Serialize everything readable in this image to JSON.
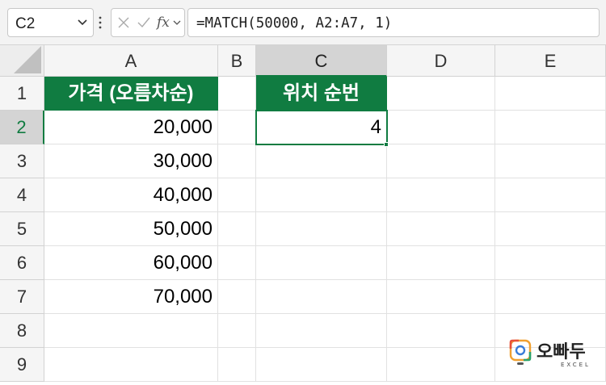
{
  "formula_bar": {
    "name_box": "C2",
    "fx_label": "fx",
    "formula": "=MATCH(50000, A2:A7, 1)"
  },
  "columns": [
    "A",
    "B",
    "C",
    "D",
    "E"
  ],
  "rows": [
    "1",
    "2",
    "3",
    "4",
    "5",
    "6",
    "7",
    "8",
    "9"
  ],
  "cells": {
    "A1": "가격 (오름차순)",
    "A2": "20,000",
    "A3": "30,000",
    "A4": "40,000",
    "A5": "50,000",
    "A6": "60,000",
    "A7": "70,000",
    "C1": "위치 순번",
    "C2": "4"
  },
  "active_cell": "C2",
  "colors": {
    "header_fill": "#107c41",
    "selection": "#107c41"
  },
  "logo": {
    "name": "오빠두",
    "subtitle": "EXCEL"
  }
}
